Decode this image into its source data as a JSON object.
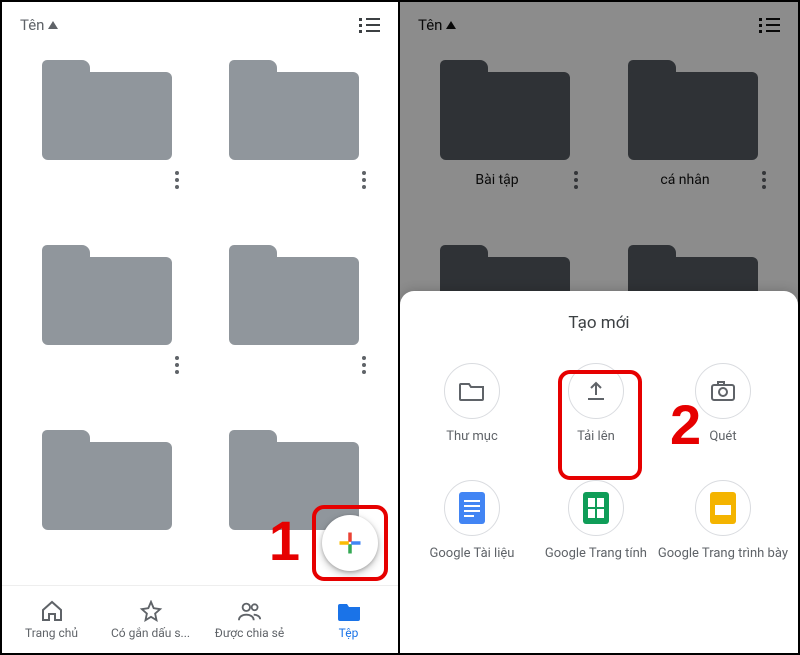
{
  "left": {
    "sort_label": "Tên",
    "folders": [
      {
        "label": ""
      },
      {
        "label": ""
      },
      {
        "label": ""
      },
      {
        "label": ""
      },
      {
        "label": ""
      },
      {
        "label": ""
      }
    ],
    "nav": {
      "home": "Trang chủ",
      "starred": "Có gắn dấu s...",
      "shared": "Được chia sẻ",
      "files": "Tệp"
    },
    "callout_number": "1"
  },
  "right": {
    "sort_label": "Tên",
    "folders": [
      {
        "label": "Bài tập"
      },
      {
        "label": "cá nhân"
      },
      {
        "label": ""
      },
      {
        "label": ""
      }
    ],
    "sheet": {
      "title": "Tạo mới",
      "items": {
        "folder": "Thư mục",
        "upload": "Tải lên",
        "scan": "Quét",
        "docs": "Google Tài liệu",
        "sheets": "Google Trang tính",
        "slides": "Google Trang trình bày"
      }
    },
    "callout_number": "2"
  }
}
